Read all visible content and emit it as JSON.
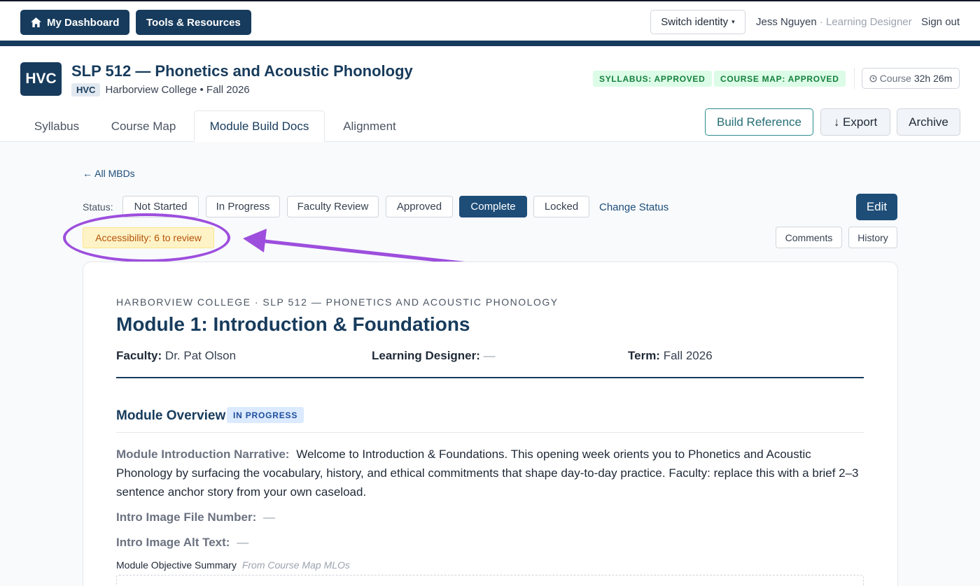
{
  "topbar": {
    "dashboard_label": "My Dashboard",
    "tools_label": "Tools & Resources",
    "switch_identity_label": "Switch identity",
    "user_name": "Jess Nguyen",
    "user_role": "· Learning Designer",
    "sign_out_label": "Sign out"
  },
  "course": {
    "logo": "HVC",
    "title": "SLP 512 — Phonetics and Acoustic Phonology",
    "institution_tag": "HVC",
    "institution_line": "Harborview College • Fall 2026",
    "syllabus_badge": "SYLLABUS: APPROVED",
    "course_map_badge": "COURSE MAP: APPROVED",
    "hours_label": "Course",
    "hours_value": "32h 26m"
  },
  "tabs": [
    {
      "label": "Syllabus"
    },
    {
      "label": "Course Map"
    },
    {
      "label": "Module Build Docs",
      "active": true
    },
    {
      "label": "Alignment"
    }
  ],
  "actions": {
    "build_reference": "Build Reference",
    "export": "↓ Export",
    "archive": "Archive"
  },
  "mbd": {
    "back_link": "← All MBDs",
    "status_label": "Status:",
    "statuses": [
      "Not Started",
      "In Progress",
      "Faculty Review",
      "Approved",
      "Complete",
      "Locked"
    ],
    "active_status": "Complete",
    "change_status": "Change Status",
    "edit": "Edit",
    "accessibility": "Accessibility: 6 to review",
    "comments": "Comments",
    "history": "History"
  },
  "document": {
    "eyebrow": "HARBORVIEW COLLEGE · SLP 512 — PHONETICS AND ACOUSTIC PHONOLOGY",
    "title": "Module 1: Introduction & Foundations",
    "faculty_label": "Faculty:",
    "faculty_value": "Dr. Pat Olson",
    "designer_label": "Learning Designer:",
    "designer_value": "—",
    "term_label": "Term:",
    "term_value": "Fall 2026",
    "section_title": "Module Overview",
    "section_badge": "IN PROGRESS",
    "narrative_label": "Module Introduction Narrative:",
    "narrative_text": "Welcome to Introduction & Foundations. This opening week orients you to Phonetics and Acoustic Phonology by surfacing the vocabulary, history, and ethical commitments that shape day-to-day practice. Faculty: replace this with a brief 2–3 sentence anchor story from your own caseload.",
    "intro_image_label": "Intro Image File Number:",
    "intro_image_value": "—",
    "alt_text_label": "Intro Image Alt Text:",
    "alt_text_value": "—",
    "objective_label": "Module Objective Summary",
    "objective_source": "From Course Map MLOs"
  },
  "colors": {
    "primary_navy": "#173b5c",
    "accent_blue": "#1e4d78",
    "teal": "#2c8c8c",
    "annotation_purple": "#9d4edd"
  }
}
